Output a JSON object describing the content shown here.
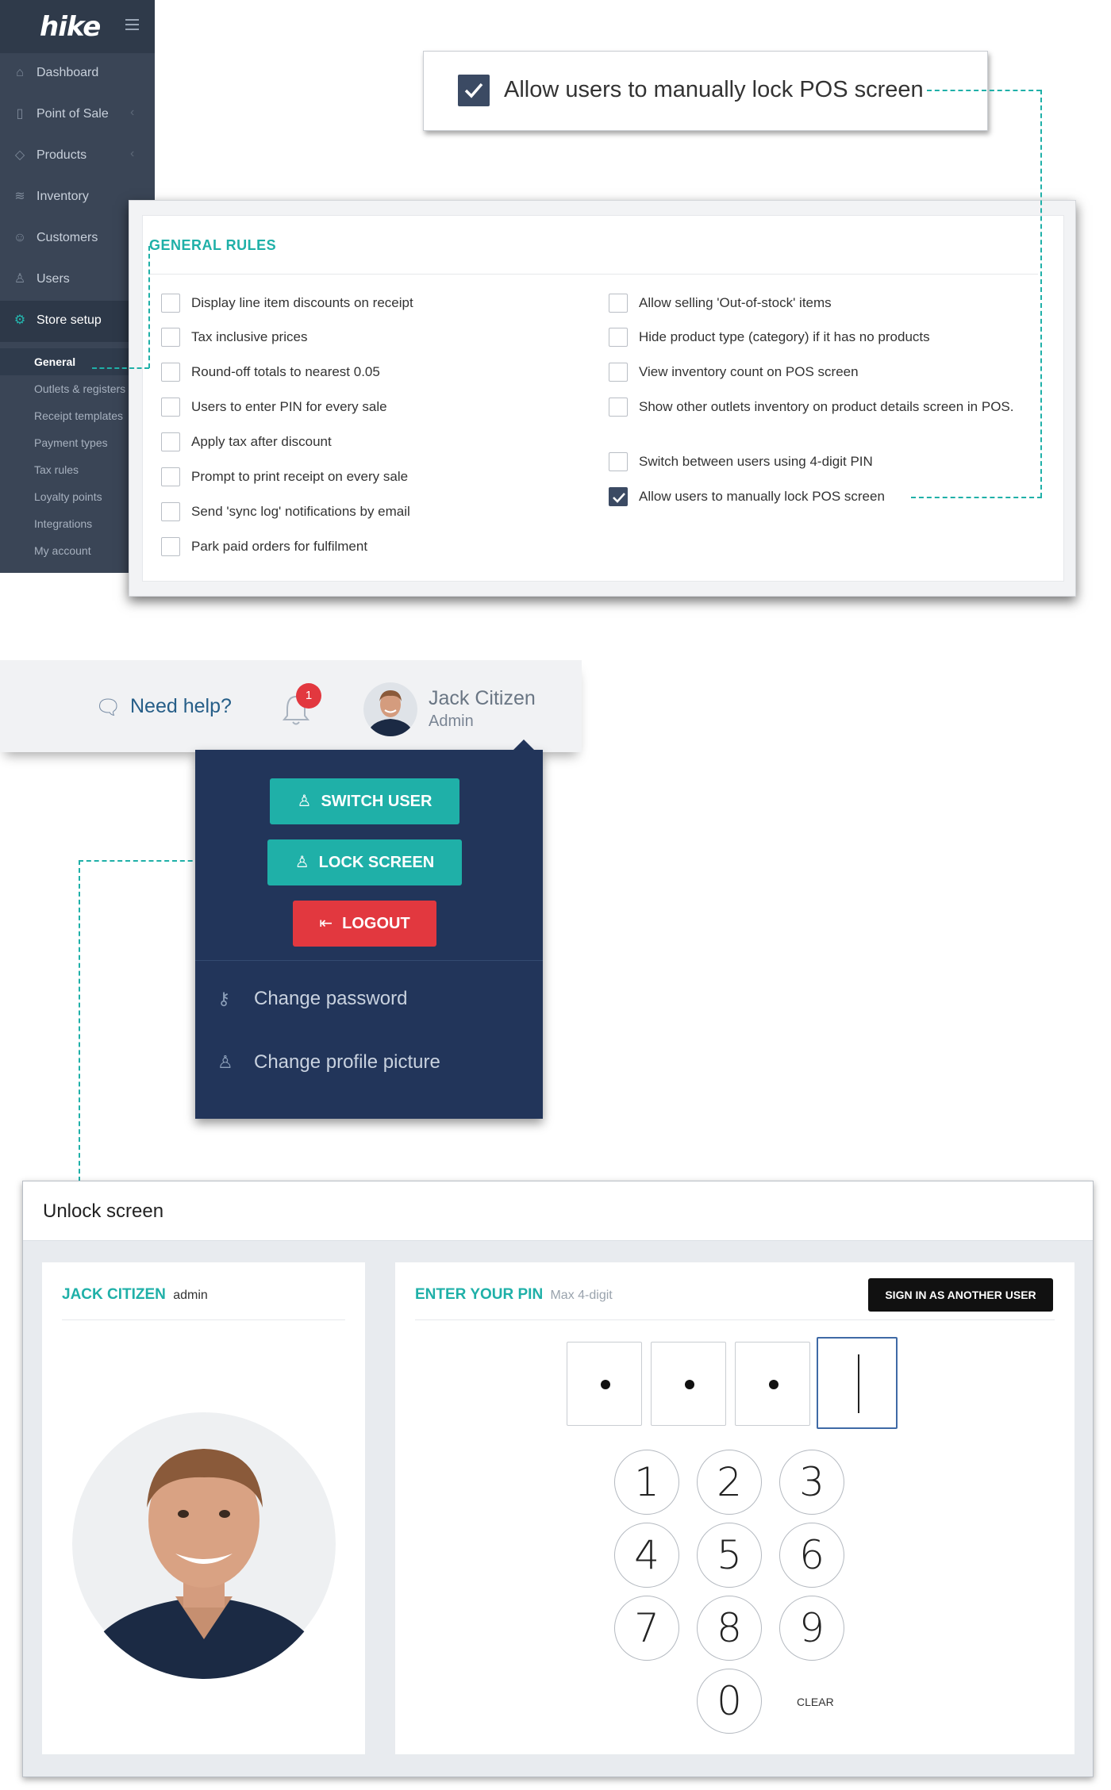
{
  "sidebar": {
    "logo": "hike",
    "items": [
      {
        "label": "Dashboard"
      },
      {
        "label": "Point of Sale"
      },
      {
        "label": "Products"
      },
      {
        "label": "Inventory"
      },
      {
        "label": "Customers"
      },
      {
        "label": "Users"
      },
      {
        "label": "Store setup"
      }
    ],
    "subitems": [
      {
        "label": "General"
      },
      {
        "label": "Outlets & registers"
      },
      {
        "label": "Receipt templates"
      },
      {
        "label": "Payment types"
      },
      {
        "label": "Tax rules"
      },
      {
        "label": "Loyalty points"
      },
      {
        "label": "Integrations"
      },
      {
        "label": "My account"
      }
    ]
  },
  "callout": {
    "label": "Allow users to manually lock POS screen",
    "checked": true
  },
  "general_rules": {
    "title": "GENERAL RULES",
    "left": [
      {
        "label": "Display line item discounts on receipt",
        "checked": false
      },
      {
        "label": "Tax inclusive prices",
        "checked": false
      },
      {
        "label": "Round-off totals to nearest 0.05",
        "checked": false
      },
      {
        "label": "Users to enter PIN for every sale",
        "checked": false
      },
      {
        "label": "Apply tax after discount",
        "checked": false
      },
      {
        "label": "Prompt to print receipt on every sale",
        "checked": false
      },
      {
        "label": "Send 'sync log' notifications by email",
        "checked": false
      },
      {
        "label": "Park paid orders for fulfilment",
        "checked": false
      }
    ],
    "right": [
      {
        "label": "Allow selling 'Out-of-stock' items",
        "checked": false
      },
      {
        "label": "Hide product type (category) if it has no products",
        "checked": false
      },
      {
        "label": "View inventory count on POS screen",
        "checked": false
      },
      {
        "label": "Show other outlets inventory on product details screen in POS.",
        "checked": false
      },
      {
        "label": "Switch between users using 4-digit PIN",
        "checked": false
      },
      {
        "label": "Allow users to manually lock POS screen",
        "checked": true
      }
    ]
  },
  "header": {
    "help_label": "Need help?",
    "notification_count": "1",
    "user_name": "Jack Citizen",
    "user_role": "Admin"
  },
  "user_menu": {
    "switch_user": "SWITCH USER",
    "lock_screen": "LOCK SCREEN",
    "logout": "LOGOUT",
    "change_password": "Change password",
    "change_picture": "Change profile picture"
  },
  "unlock": {
    "title": "Unlock screen",
    "user_name": "JACK CITIZEN",
    "user_role": "admin",
    "pin_heading": "ENTER YOUR PIN",
    "pin_hint": "Max 4-digit",
    "sign_in_other": "SIGN IN AS ANOTHER USER",
    "pin_filled": 3,
    "keys": [
      "1",
      "2",
      "3",
      "4",
      "5",
      "6",
      "7",
      "8",
      "9",
      "0"
    ],
    "clear": "CLEAR"
  },
  "colors": {
    "accent": "#1fb0a8",
    "sidebar": "#3a4556",
    "menu_bg": "#22355a",
    "danger": "#e2383f",
    "checkbox_checked": "#3b4a63"
  }
}
